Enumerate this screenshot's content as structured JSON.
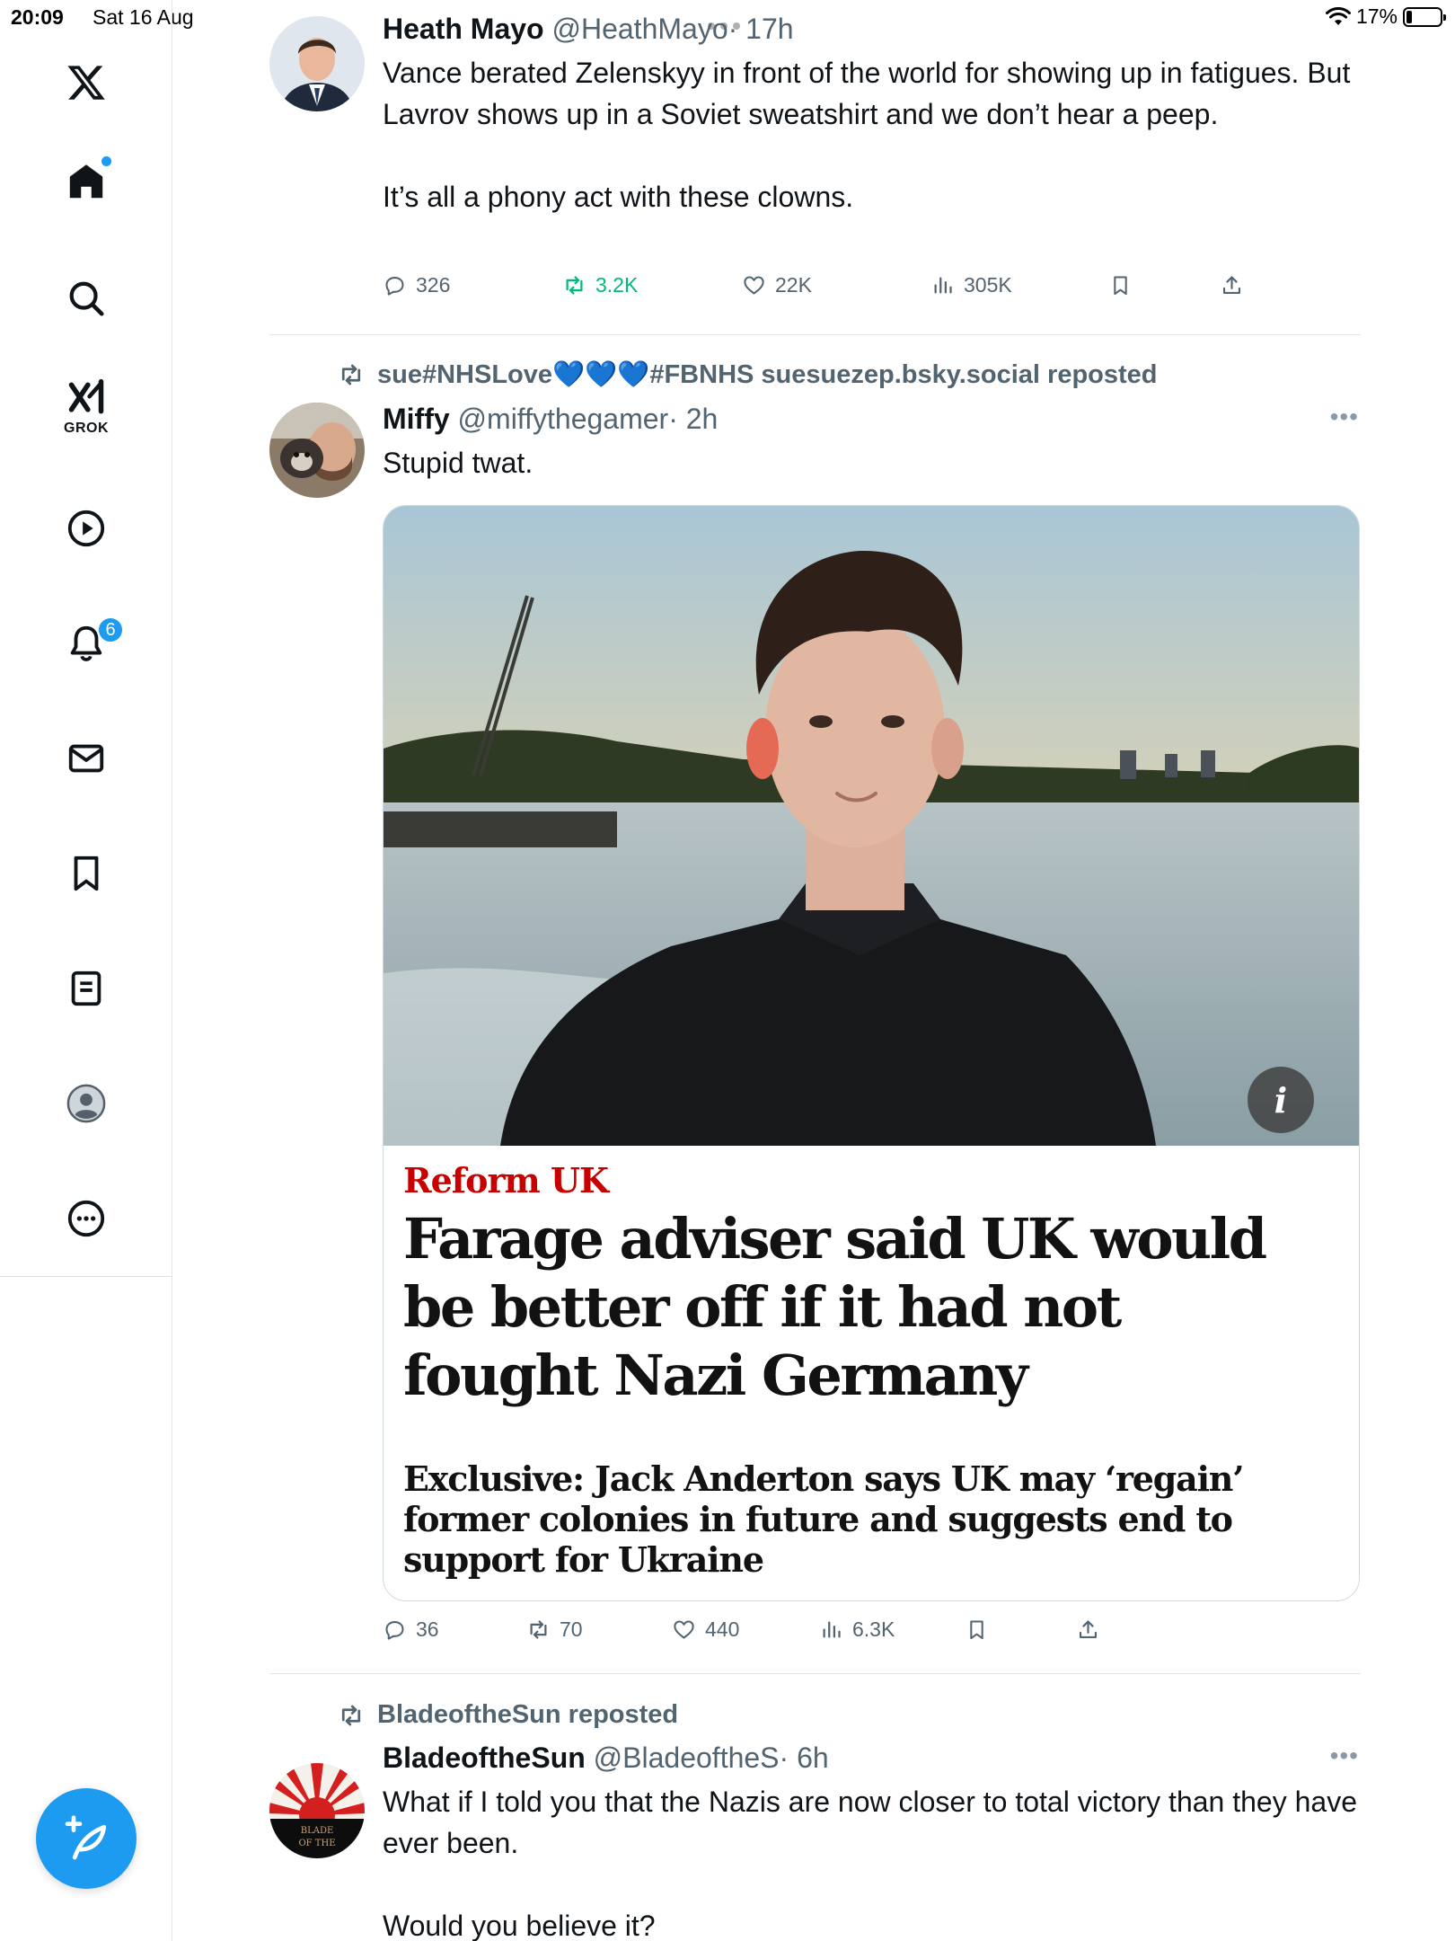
{
  "status_bar": {
    "time": "20:09",
    "date": "Sat 16 Aug",
    "battery": "17%"
  },
  "sidebar": {
    "grok_label": "GROK",
    "notification_count": "6",
    "accent": "#1d9bf0"
  },
  "tweets": [
    {
      "name": "Heath Mayo",
      "handle": "@HeathMayo",
      "time": "· 17h",
      "paragraphs": [
        "Vance berated Zelenskyy in front of the world for showing up in fatigues. But Lavrov shows up in a Soviet sweatshirt and we don’t hear a peep.",
        "It’s all a phony act with these clowns."
      ],
      "replies": "326",
      "reposts": "3.2K",
      "likes": "22K",
      "views": "305K"
    },
    {
      "reposted_by": "sue#NHSLove💙💙💙#FBNHS suesuezep.bsky.social reposted",
      "name": "Miffy",
      "handle": "@miffythegamer",
      "time": "· 2h",
      "paragraphs": [
        "Stupid twat."
      ],
      "card": {
        "kicker": "Reform UK",
        "headline": "Farage adviser said UK would be better off if it had not fought Nazi Germany",
        "standfirst": "Exclusive: Jack Anderton says UK may ‘regain’ former colonies in future and suggests end to support for Ukraine",
        "kicker_color": "#c70000"
      },
      "replies": "36",
      "reposts": "70",
      "likes": "440",
      "views": "6.3K"
    },
    {
      "reposted_by": "BladeoftheSun reposted",
      "name": "BladeoftheSun",
      "handle": "@BladeoftheS",
      "time": "· 6h",
      "paragraphs": [
        "What if I told you that the Nazis are now closer to total victory than they have ever been.",
        "Would you believe it?"
      ],
      "avatar_text": "BLADE OF THE"
    }
  ]
}
